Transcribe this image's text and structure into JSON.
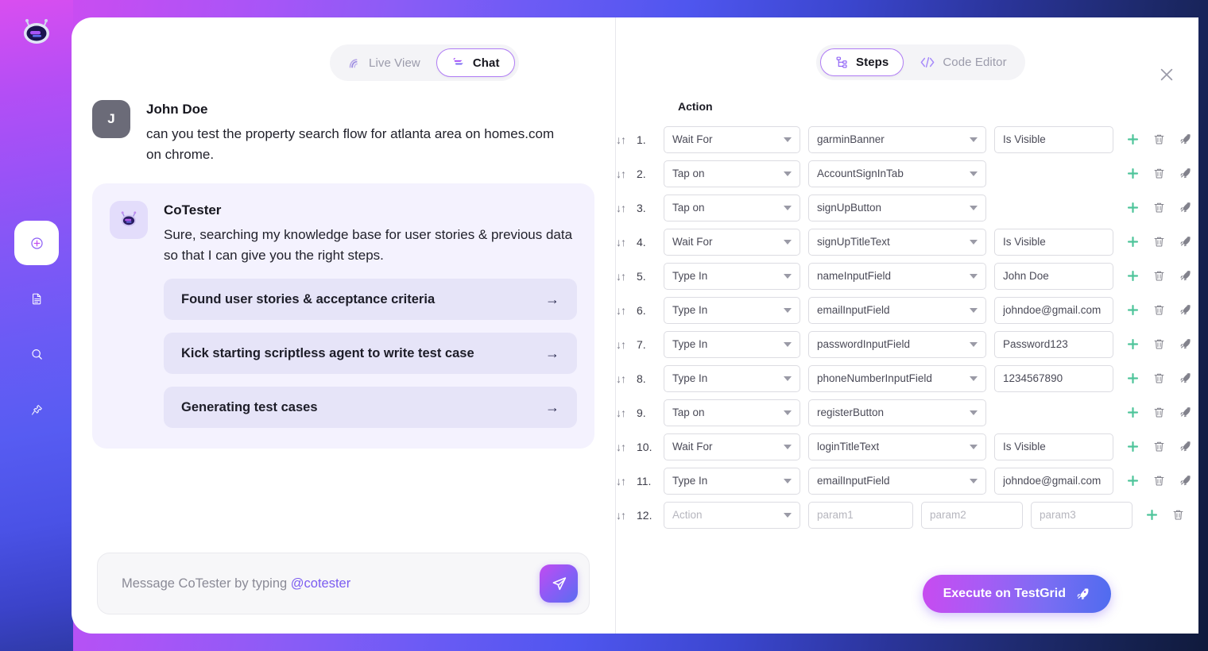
{
  "app": {
    "logo_icon": "cotester-robot-logo"
  },
  "rail": {
    "items": [
      {
        "icon": "plus-circle-icon",
        "name": "new-chat",
        "active": true
      },
      {
        "icon": "document-icon",
        "name": "documents",
        "active": false
      },
      {
        "icon": "search-icon",
        "name": "search",
        "active": false
      },
      {
        "icon": "plug-connect-icon",
        "name": "integrations",
        "active": false
      }
    ]
  },
  "left_pane": {
    "tabs": [
      {
        "label": "Live View",
        "icon": "live-view-icon",
        "active": false
      },
      {
        "label": "Chat",
        "icon": "chat-icon",
        "active": true
      }
    ],
    "messages": [
      {
        "author": "John Doe",
        "avatar_initial": "J",
        "avatar_type": "user",
        "text": "can you test the property search flow for atlanta area on homes.com on chrome."
      },
      {
        "author": "CoTester",
        "avatar_type": "bot",
        "avatar_icon": "cotester-robot-icon",
        "text": "Sure, searching my knowledge base for user stories & previous data so that I can give you the right steps.",
        "actions": [
          {
            "label": "Found user stories & acceptance criteria",
            "arrow": "→"
          },
          {
            "label": "Kick starting scriptless agent to write test case",
            "arrow": "→"
          },
          {
            "label": "Generating test cases",
            "arrow": "→"
          }
        ]
      }
    ],
    "composer": {
      "placeholder_prefix": "Message CoTester by typing ",
      "placeholder_mention": "@cotester",
      "send_icon": "send-paper-plane-icon"
    }
  },
  "right_pane": {
    "tabs": [
      {
        "label": "Steps",
        "icon": "steps-flow-icon",
        "active": true
      },
      {
        "label": "Code Editor",
        "icon": "code-brackets-icon",
        "active": false
      }
    ],
    "close_icon": "close-icon",
    "column_header": "Action",
    "row_icons": {
      "add": "plus-icon",
      "delete": "trash-icon",
      "run": "rocket-icon",
      "reorder": "reorder-arrows-icon"
    },
    "steps": [
      {
        "num": "1.",
        "action": "Wait For",
        "target": "garminBanner",
        "value": "Is Visible",
        "target_has_caret": true,
        "has_value": true
      },
      {
        "num": "2.",
        "action": "Tap on",
        "target": "AccountSignInTab",
        "value": "",
        "target_has_caret": true,
        "has_value": false
      },
      {
        "num": "3.",
        "action": "Tap on",
        "target": "signUpButton",
        "value": "",
        "target_has_caret": true,
        "has_value": false
      },
      {
        "num": "4.",
        "action": "Wait For",
        "target": "signUpTitleText",
        "value": "Is Visible",
        "target_has_caret": true,
        "has_value": true
      },
      {
        "num": "5.",
        "action": "Type In",
        "target": "nameInputField",
        "value": "John Doe",
        "target_has_caret": true,
        "has_value": true
      },
      {
        "num": "6.",
        "action": "Type In",
        "target": "emailInputField",
        "value": "johndoe@gmail.com",
        "target_has_caret": true,
        "has_value": true
      },
      {
        "num": "7.",
        "action": "Type In",
        "target": "passwordInputField",
        "value": "Password123",
        "target_has_caret": true,
        "has_value": true
      },
      {
        "num": "8.",
        "action": "Type In",
        "target": "phoneNumberInputField",
        "value": "1234567890",
        "target_has_caret": true,
        "has_value": true
      },
      {
        "num": "9.",
        "action": "Tap on",
        "target": "registerButton",
        "value": "",
        "target_has_caret": true,
        "has_value": false
      },
      {
        "num": "10.",
        "action": "Wait For",
        "target": "loginTitleText",
        "value": "Is Visible",
        "target_has_caret": true,
        "has_value": true
      },
      {
        "num": "11.",
        "action": "Type In",
        "target": "emailInputField",
        "value": "johndoe@gmail.com",
        "target_has_caret": true,
        "has_value": true
      }
    ],
    "empty_row": {
      "num": "12.",
      "action_placeholder": "Action",
      "param1_placeholder": "param1",
      "param2_placeholder": "param2",
      "param3_placeholder": "param3"
    },
    "execute_button": {
      "label": "Execute on TestGrid",
      "icon": "rocket-icon"
    }
  },
  "colors": {
    "accent_purple": "#8b5cf6",
    "accent_magenta": "#d24bf0",
    "accent_blue": "#4f6cef",
    "add_green": "#4ec49a",
    "icon_gray": "#7a7a88",
    "bot_bubble": "#f4f2fe",
    "action_card": "#e6e4f8"
  }
}
